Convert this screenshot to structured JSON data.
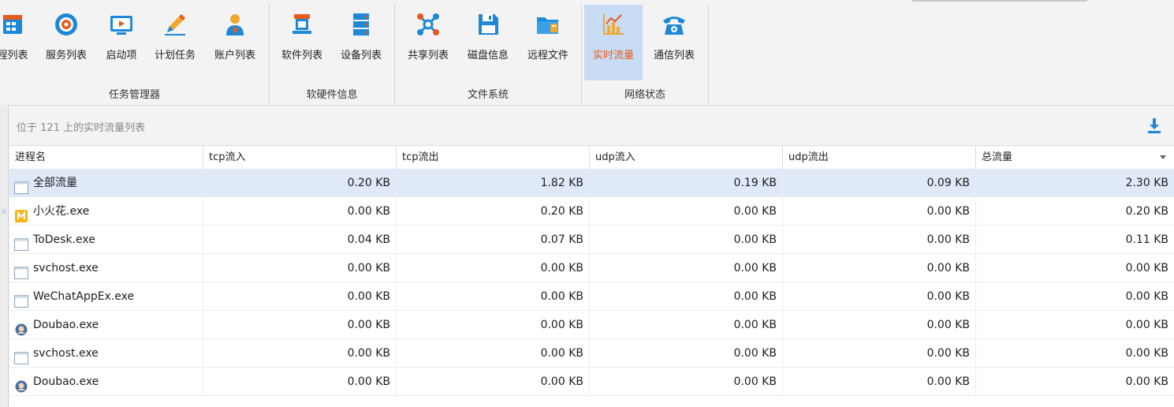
{
  "ribbon": {
    "groups": [
      {
        "label": "任务管理器",
        "buttons": [
          {
            "label": "程列表",
            "icon": "process-list-icon"
          },
          {
            "label": "服务列表",
            "icon": "services-icon"
          },
          {
            "label": "启动项",
            "icon": "startup-icon"
          },
          {
            "label": "计划任务",
            "icon": "scheduled-task-icon"
          },
          {
            "label": "账户列表",
            "icon": "user-account-icon"
          }
        ]
      },
      {
        "label": "软硬件信息",
        "buttons": [
          {
            "label": "软件列表",
            "icon": "software-icon"
          },
          {
            "label": "设备列表",
            "icon": "devices-icon"
          }
        ]
      },
      {
        "label": "文件系统",
        "buttons": [
          {
            "label": "共享列表",
            "icon": "share-icon"
          },
          {
            "label": "磁盘信息",
            "icon": "disk-icon"
          },
          {
            "label": "远程文件",
            "icon": "remote-folder-icon"
          }
        ]
      },
      {
        "label": "网络状态",
        "buttons": [
          {
            "label": "实时流量",
            "icon": "traffic-chart-icon",
            "active": true
          },
          {
            "label": "通信列表",
            "icon": "telephone-icon"
          }
        ]
      }
    ]
  },
  "panel": {
    "title": "位于 121 上的实时流量列表",
    "download_icon": "download-icon"
  },
  "table": {
    "columns": [
      "进程名",
      "tcp流入",
      "tcp流出",
      "udp流入",
      "udp流出",
      "总流量"
    ],
    "rows": [
      {
        "name": "全部流量",
        "icon": "window-icon",
        "tcp_in": "0.20 KB",
        "tcp_out": "1.82 KB",
        "udp_in": "0.19 KB",
        "udp_out": "0.09 KB",
        "total": "2.30 KB",
        "selected": true
      },
      {
        "name": "小火花.exe",
        "icon": "spark-app-icon",
        "tcp_in": "0.00 KB",
        "tcp_out": "0.20 KB",
        "udp_in": "0.00 KB",
        "udp_out": "0.00 KB",
        "total": "0.20 KB"
      },
      {
        "name": "ToDesk.exe",
        "icon": "window-icon",
        "tcp_in": "0.04 KB",
        "tcp_out": "0.07 KB",
        "udp_in": "0.00 KB",
        "udp_out": "0.00 KB",
        "total": "0.11 KB"
      },
      {
        "name": "svchost.exe",
        "icon": "window-icon",
        "tcp_in": "0.00 KB",
        "tcp_out": "0.00 KB",
        "udp_in": "0.00 KB",
        "udp_out": "0.00 KB",
        "total": "0.00 KB"
      },
      {
        "name": "WeChatAppEx.exe",
        "icon": "window-icon",
        "tcp_in": "0.00 KB",
        "tcp_out": "0.00 KB",
        "udp_in": "0.00 KB",
        "udp_out": "0.00 KB",
        "total": "0.00 KB"
      },
      {
        "name": "Doubao.exe",
        "icon": "doubao-avatar-icon",
        "tcp_in": "0.00 KB",
        "tcp_out": "0.00 KB",
        "udp_in": "0.00 KB",
        "udp_out": "0.00 KB",
        "total": "0.00 KB"
      },
      {
        "name": "svchost.exe",
        "icon": "window-icon",
        "tcp_in": "0.00 KB",
        "tcp_out": "0.00 KB",
        "udp_in": "0.00 KB",
        "udp_out": "0.00 KB",
        "total": "0.00 KB"
      },
      {
        "name": "Doubao.exe",
        "icon": "doubao-avatar-icon",
        "tcp_in": "0.00 KB",
        "tcp_out": "0.00 KB",
        "udp_in": "0.00 KB",
        "udp_out": "0.00 KB",
        "total": "0.00 KB"
      }
    ]
  },
  "colors": {
    "accent_orange": "#e85a1a",
    "active_bg": "#c9dcf5",
    "selected_row": "#dfe9f7",
    "icon_blue": "#1e88d8"
  }
}
